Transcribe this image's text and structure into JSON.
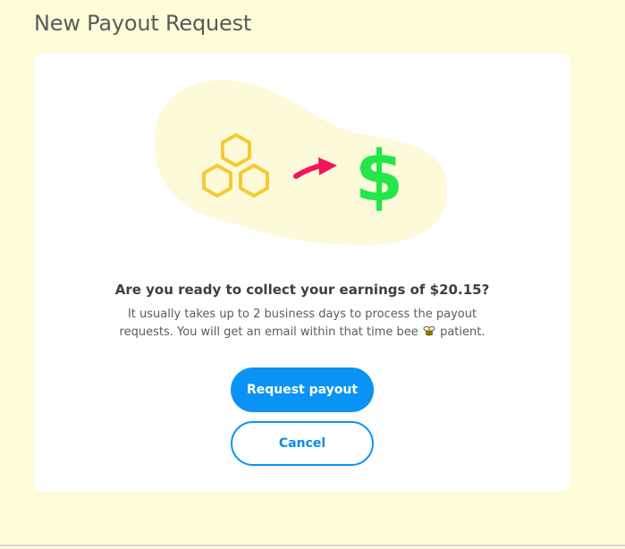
{
  "page": {
    "title": "New Payout Request"
  },
  "dialog": {
    "question": "Are you ready to collect your earnings of $20.15?",
    "description_part1": "It usually takes up to 2 business days to process the payout requests. You will get an email within that time bee",
    "description_part2": "patient.",
    "icons": [
      "honeycomb-icon",
      "arrow-icon",
      "dollar-icon",
      "bee-icon"
    ]
  },
  "actions": {
    "request_label": "Request payout",
    "cancel_label": "Cancel"
  },
  "colors": {
    "background": "#fffdd9",
    "blob": "#fdfad9",
    "honeycomb": "#f7c934",
    "arrow": "#f2145e",
    "dollar": "#22e64a",
    "primary": "#0a93f5"
  }
}
